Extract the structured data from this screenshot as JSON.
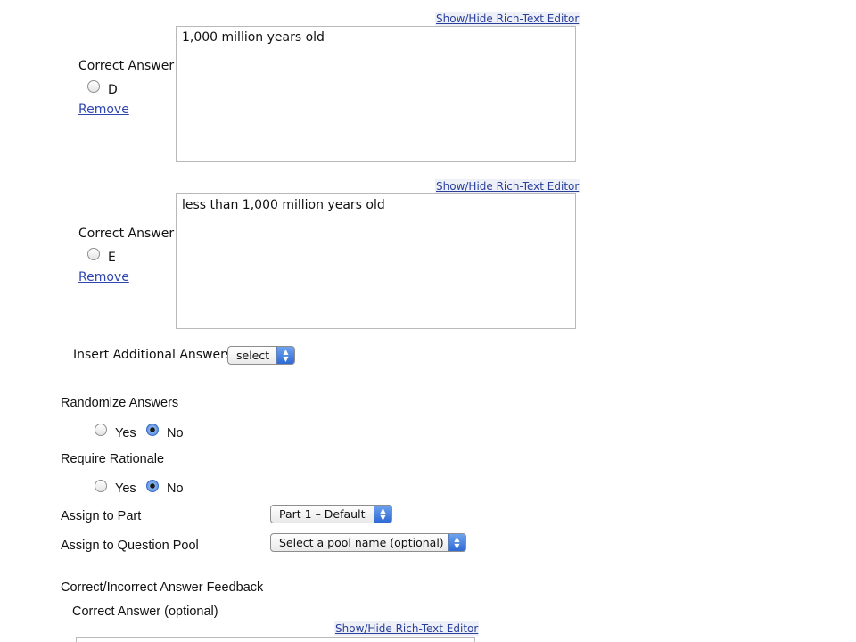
{
  "rich_text_toggle_label": "Show/Hide Rich-Text Editor",
  "answers": [
    {
      "correct_answer_label": "Correct Answer",
      "letter": "D",
      "text": "1,000 million years old",
      "remove_label": "Remove"
    },
    {
      "correct_answer_label": "Correct Answer",
      "letter": "E",
      "text": "less than 1,000 million years old",
      "remove_label": "Remove"
    }
  ],
  "insert_additional": {
    "label": "Insert Additional Answers",
    "selected": "select"
  },
  "randomize": {
    "label": "Randomize Answers",
    "yes": "Yes",
    "no": "No",
    "value": "No"
  },
  "rationale": {
    "label": "Require Rationale",
    "yes": "Yes",
    "no": "No",
    "value": "No"
  },
  "assign_part": {
    "label": "Assign to Part",
    "selected": "Part 1 – Default"
  },
  "assign_pool": {
    "label": "Assign to Question Pool",
    "selected": "Select a pool name (optional)"
  },
  "feedback": {
    "heading": "Correct/Incorrect Answer Feedback",
    "correct_label": "Correct Answer (optional)"
  },
  "icons": {
    "select_arrows": "up-down-arrows-icon"
  }
}
